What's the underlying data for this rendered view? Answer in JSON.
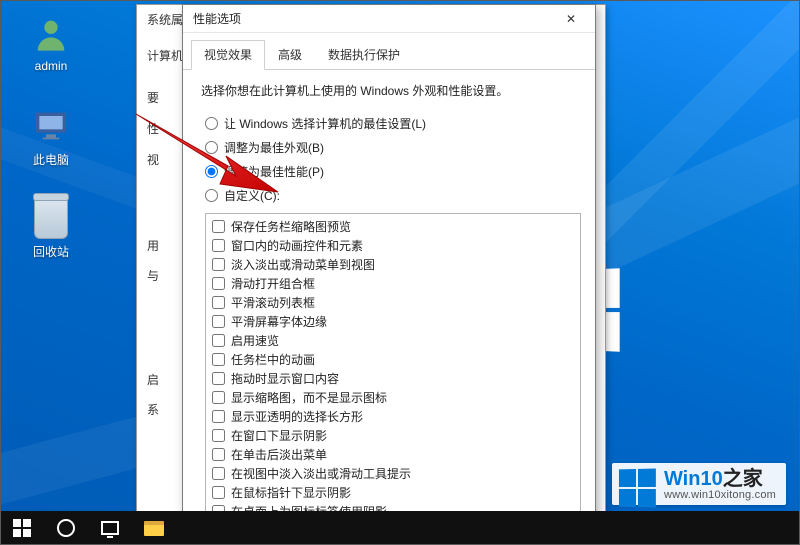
{
  "desktop": {
    "icons": [
      {
        "label": "admin"
      },
      {
        "label": "此电脑"
      },
      {
        "label": "回收站"
      }
    ]
  },
  "dialog_back": {
    "title": "系统属",
    "rows": [
      "计算机",
      "要",
      "性",
      "视",
      "用",
      "与",
      "启",
      "系"
    ]
  },
  "dialog": {
    "title": "性能选项",
    "close": "✕",
    "tabs": [
      {
        "label": "视觉效果",
        "active": true
      },
      {
        "label": "高级",
        "active": false
      },
      {
        "label": "数据执行保护",
        "active": false
      }
    ],
    "intro": "选择你想在此计算机上使用的 Windows 外观和性能设置。",
    "radios": [
      {
        "label": "让 Windows 选择计算机的最佳设置(L)",
        "checked": false
      },
      {
        "label": "调整为最佳外观(B)",
        "checked": false
      },
      {
        "label": "调整为最佳性能(P)",
        "checked": true
      },
      {
        "label": "自定义(C):",
        "checked": false
      }
    ],
    "checks": [
      "保存任务栏缩略图预览",
      "窗口内的动画控件和元素",
      "淡入淡出或滑动菜单到视图",
      "滑动打开组合框",
      "平滑滚动列表框",
      "平滑屏幕字体边缘",
      "启用速览",
      "任务栏中的动画",
      "拖动时显示窗口内容",
      "显示缩略图，而不是显示图标",
      "显示亚透明的选择长方形",
      "在窗口下显示阴影",
      "在单击后淡出菜单",
      "在视图中淡入淡出或滑动工具提示",
      "在鼠标指针下显示阴影",
      "在桌面上为图标标签使用阴影"
    ]
  },
  "watermark": {
    "brand_a": "Win10",
    "brand_b": "之家",
    "url": "www.win10xitong.com"
  }
}
